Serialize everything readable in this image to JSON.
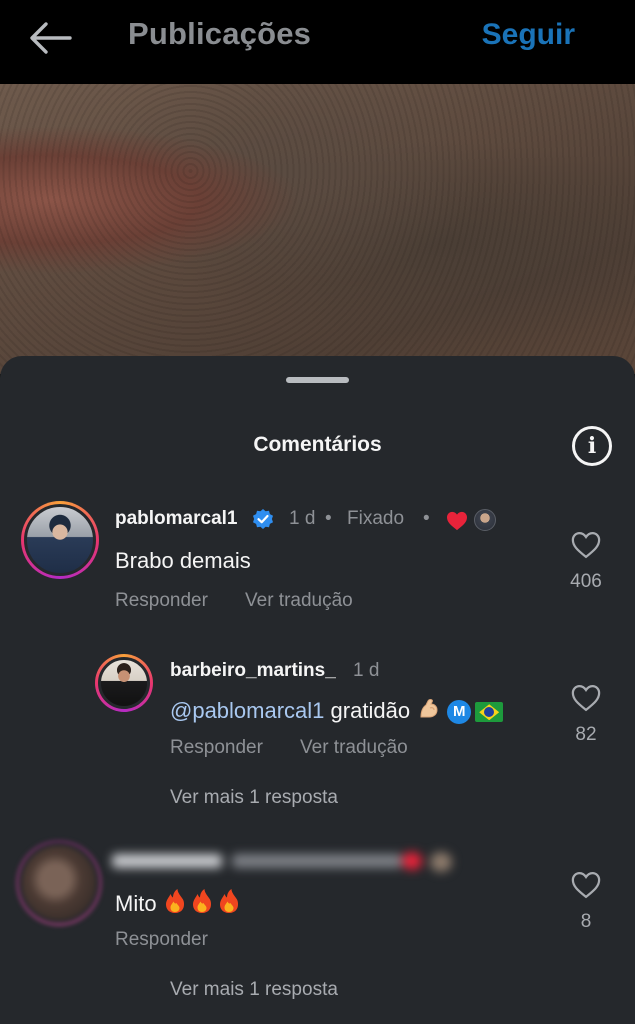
{
  "header": {
    "title": "Publicações",
    "follow_label": "Seguir"
  },
  "sheet": {
    "title": "Comentários"
  },
  "comments": [
    {
      "username": "pablomarcal1",
      "time": "1 d",
      "separator": "•",
      "pinned": "Fixado",
      "text": "Brabo demais",
      "reply_label": "Responder",
      "translate_label": "Ver tradução",
      "likes": "406"
    },
    {
      "username": "barbeiro_martins_",
      "time": "1 d",
      "mention": "@pablomarcal1",
      "text": "gratidão",
      "badge_letter": "M",
      "reply_label": "Responder",
      "translate_label": "Ver tradução",
      "likes": "82",
      "more_replies": "Ver mais 1 resposta"
    },
    {
      "username": "",
      "text": "Mito",
      "reply_label": "Responder",
      "likes": "8",
      "more_replies": "Ver mais 1 resposta"
    }
  ],
  "colors": {
    "follow": "#1a73b8",
    "verified": "#2f8ef0",
    "heart": "#e8233a",
    "mention": "#a9c8f0"
  },
  "icons": [
    "back-arrow-icon",
    "info-icon",
    "verified-badge-icon",
    "heart-icon",
    "flexed-biceps-emoji",
    "brazil-flag-emoji",
    "fire-emoji"
  ]
}
